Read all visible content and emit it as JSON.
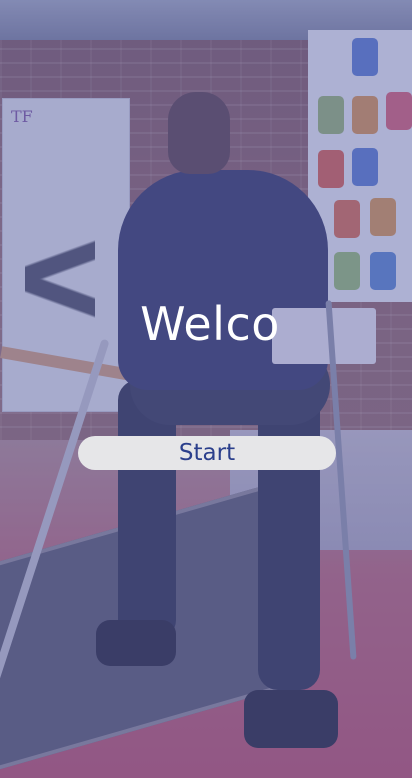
{
  "welcome": {
    "title": "Welco"
  },
  "start_button": {
    "label": "Start"
  },
  "background": {
    "description_icon": "exoskeleton-photo",
    "poster_logo": "TF"
  },
  "colors": {
    "overlay": "#545caa",
    "button_bg": "#e6e6e8",
    "button_text": "#2b3f8c",
    "title_text": "#ffffff"
  }
}
